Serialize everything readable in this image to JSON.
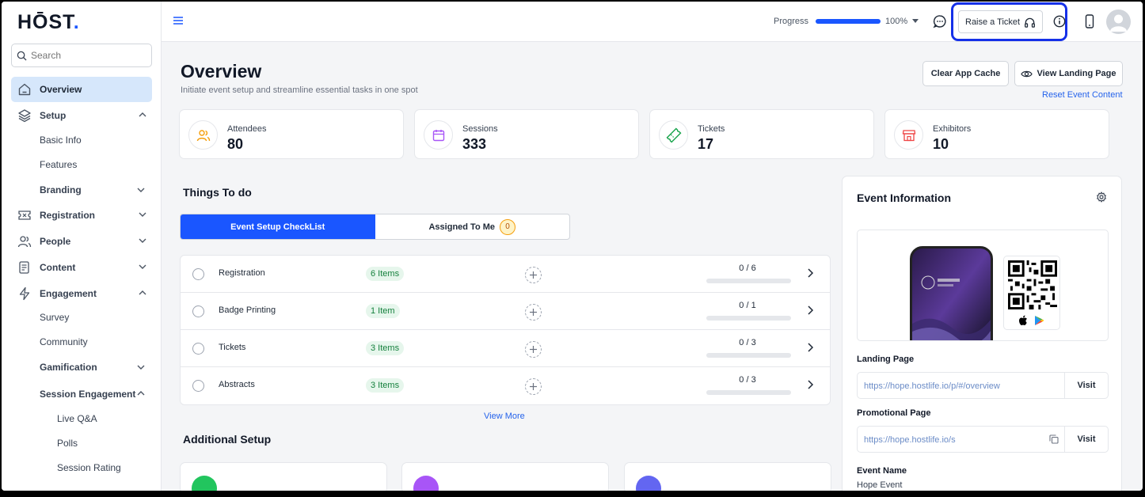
{
  "app": {
    "logo_text": "HŌST",
    "logo_dot": "."
  },
  "sidebar": {
    "search_placeholder": "Search",
    "items": [
      {
        "label": "Overview",
        "icon": "home-icon"
      },
      {
        "label": "Setup",
        "icon": "layers-icon"
      },
      {
        "label": "Registration",
        "icon": "ticket-icon"
      },
      {
        "label": "People",
        "icon": "users-icon"
      },
      {
        "label": "Content",
        "icon": "document-icon"
      },
      {
        "label": "Engagement",
        "icon": "lightning-icon"
      }
    ],
    "setup_sub": [
      "Basic Info",
      "Features",
      "Branding"
    ],
    "engagement_sub": [
      "Survey",
      "Community",
      "Gamification",
      "Session Engagement"
    ],
    "session_engagement_sub": [
      "Live Q&A",
      "Polls",
      "Session Rating"
    ]
  },
  "topbar": {
    "progress_label": "Progress",
    "progress_value": "100%",
    "progress_fraction": 1.0,
    "raise_ticket": "Raise a Ticket"
  },
  "overview": {
    "title": "Overview",
    "subtitle": "Initiate event setup and streamline essential tasks in one spot",
    "clear_cache": "Clear App Cache",
    "view_landing": "View Landing Page",
    "reset_content": "Reset Event Content"
  },
  "stats": [
    {
      "label": "Attendees",
      "value": "80",
      "icon": "users-icon",
      "color": "#f59e0b"
    },
    {
      "label": "Sessions",
      "value": "333",
      "icon": "calendar-icon",
      "color": "#a855f7"
    },
    {
      "label": "Tickets",
      "value": "17",
      "icon": "ticket-icon",
      "color": "#16a34a"
    },
    {
      "label": "Exhibitors",
      "value": "10",
      "icon": "store-icon",
      "color": "#ef4444"
    }
  ],
  "todo": {
    "title": "Things To do",
    "tab_checklist": "Event Setup CheckList",
    "tab_assigned": "Assigned To Me",
    "assigned_count": "0",
    "rows": [
      {
        "name": "Registration",
        "badge": "6 Items",
        "count": "0 / 6",
        "fraction": 0
      },
      {
        "name": "Badge Printing",
        "badge": "1 Item",
        "count": "0 / 1",
        "fraction": 0
      },
      {
        "name": "Tickets",
        "badge": "3 Items",
        "count": "0 / 3",
        "fraction": 0
      },
      {
        "name": "Abstracts",
        "badge": "3 Items",
        "count": "0 / 3",
        "fraction": 0
      }
    ],
    "view_more": "View More"
  },
  "additional": {
    "title": "Additional Setup"
  },
  "event_info": {
    "title": "Event Information",
    "landing_label": "Landing Page",
    "landing_url": "https://hope.hostlife.io/p/#/overview",
    "promo_label": "Promotional Page",
    "promo_url": "https://hope.hostlife.io/s",
    "visit": "Visit",
    "event_name_label": "Event Name",
    "event_name": "Hope Event"
  }
}
